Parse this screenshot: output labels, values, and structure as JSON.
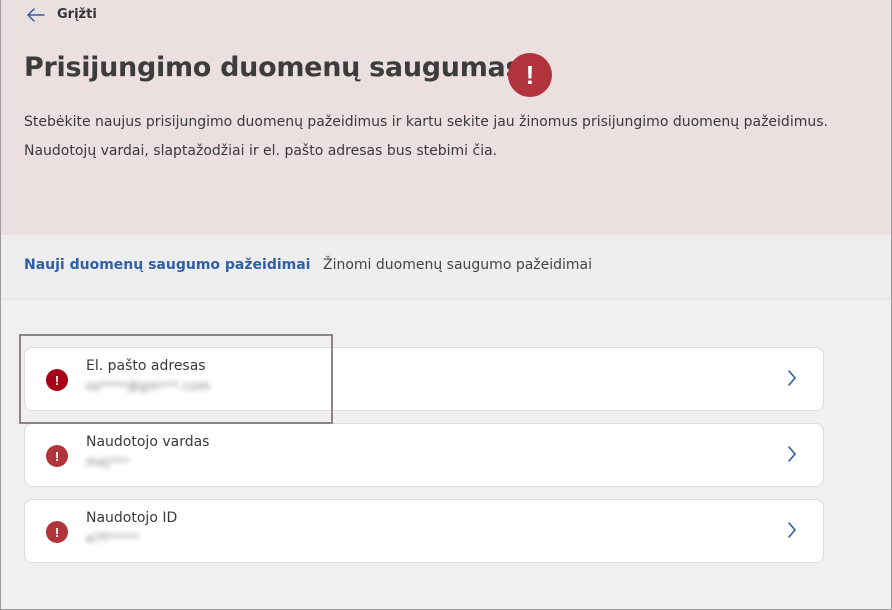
{
  "header": {
    "back_label": "Grįžti",
    "title": "Prisijungimo duomenų saugumas",
    "alert_glyph": "!",
    "description_line1": "Stebėkite naujus prisijungimo duomenų pažeidimus ir kartu sekite jau žinomus prisijungimo duomenų pažeidimus.",
    "description_line2": "Naudotojų vardai, slaptažodžiai ir el. pašto adresas bus stebimi čia."
  },
  "tabs": [
    {
      "label": "Nauji duomenų saugumo pažeidimai",
      "active": true
    },
    {
      "label": "Žinomi duomenų saugumo pažeidimai",
      "active": false
    }
  ],
  "items": [
    {
      "label": "El. pašto adresas",
      "value": "se****@gm***.com",
      "alert_glyph": "!"
    },
    {
      "label": "Naudotojo vardas",
      "value": "mej***",
      "alert_glyph": "!"
    },
    {
      "label": "Naudotojo ID",
      "value": "a7f*****",
      "alert_glyph": "!"
    }
  ],
  "colors": {
    "hero_bg": "#ecdfdf",
    "alert_red": "#b1333c",
    "alert_red_dark": "#a9001a",
    "link_blue": "#2e5fa8",
    "highlight_border": "#8d8484"
  },
  "icons": {
    "back": "arrow-left-icon",
    "alert": "exclamation-circle-icon",
    "chevron": "chevron-right-icon"
  }
}
